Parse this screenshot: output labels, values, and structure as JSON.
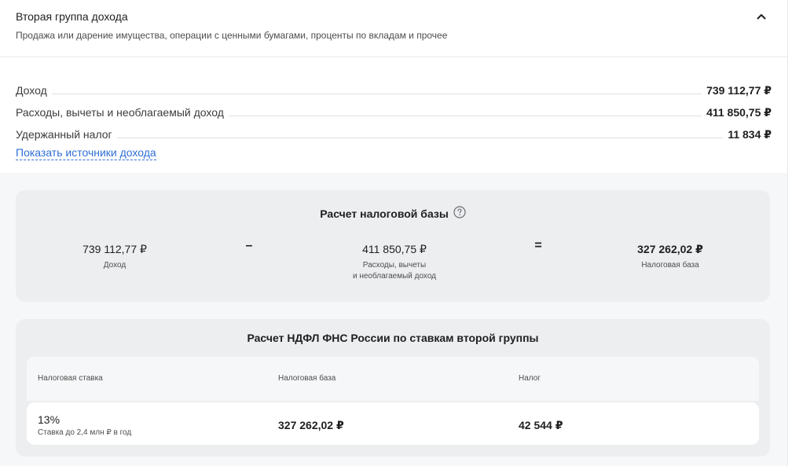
{
  "section": {
    "title": "Вторая группа дохода",
    "subtitle": "Продажа или дарение имущества, операции с ценными бумагами, проценты по вкладам и прочее",
    "collapse_icon": "chevron-up-icon"
  },
  "summary": {
    "rows": [
      {
        "label": "Доход",
        "value": "739 112,77 ₽"
      },
      {
        "label": "Расходы, вычеты и необлагаемый доход",
        "value": "411 850,75 ₽"
      },
      {
        "label": "Удержанный налог",
        "value": "11 834 ₽"
      }
    ],
    "link": "Показать источники дохода"
  },
  "tax_base": {
    "title": "Расчет налоговой базы",
    "help_icon": "question-circle-icon",
    "income": {
      "value": "739 112,77 ₽",
      "caption": "Доход"
    },
    "minus": "–",
    "deductions": {
      "value": "411 850,75 ₽",
      "caption_line1": "Расходы, вычеты",
      "caption_line2": "и необлагаемый доход"
    },
    "equals": "=",
    "result": {
      "value": "327 262,02 ₽",
      "caption": "Налоговая база"
    }
  },
  "ndfl": {
    "title": "Расчет НДФЛ ФНС России по ставкам второй группы",
    "headers": [
      "Налоговая ставка",
      "Налоговая база",
      "Налог"
    ],
    "rows": [
      {
        "rate": "13%",
        "rate_note": "Ставка до 2,4 млн ₽ в год",
        "base": "327 262,02 ₽",
        "tax": "42 544 ₽"
      }
    ]
  },
  "colors": {
    "link": "#2f6fd6",
    "card_bg": "#eceef0",
    "area_bg": "#f6f7f8",
    "text": "#1f1f1f"
  }
}
